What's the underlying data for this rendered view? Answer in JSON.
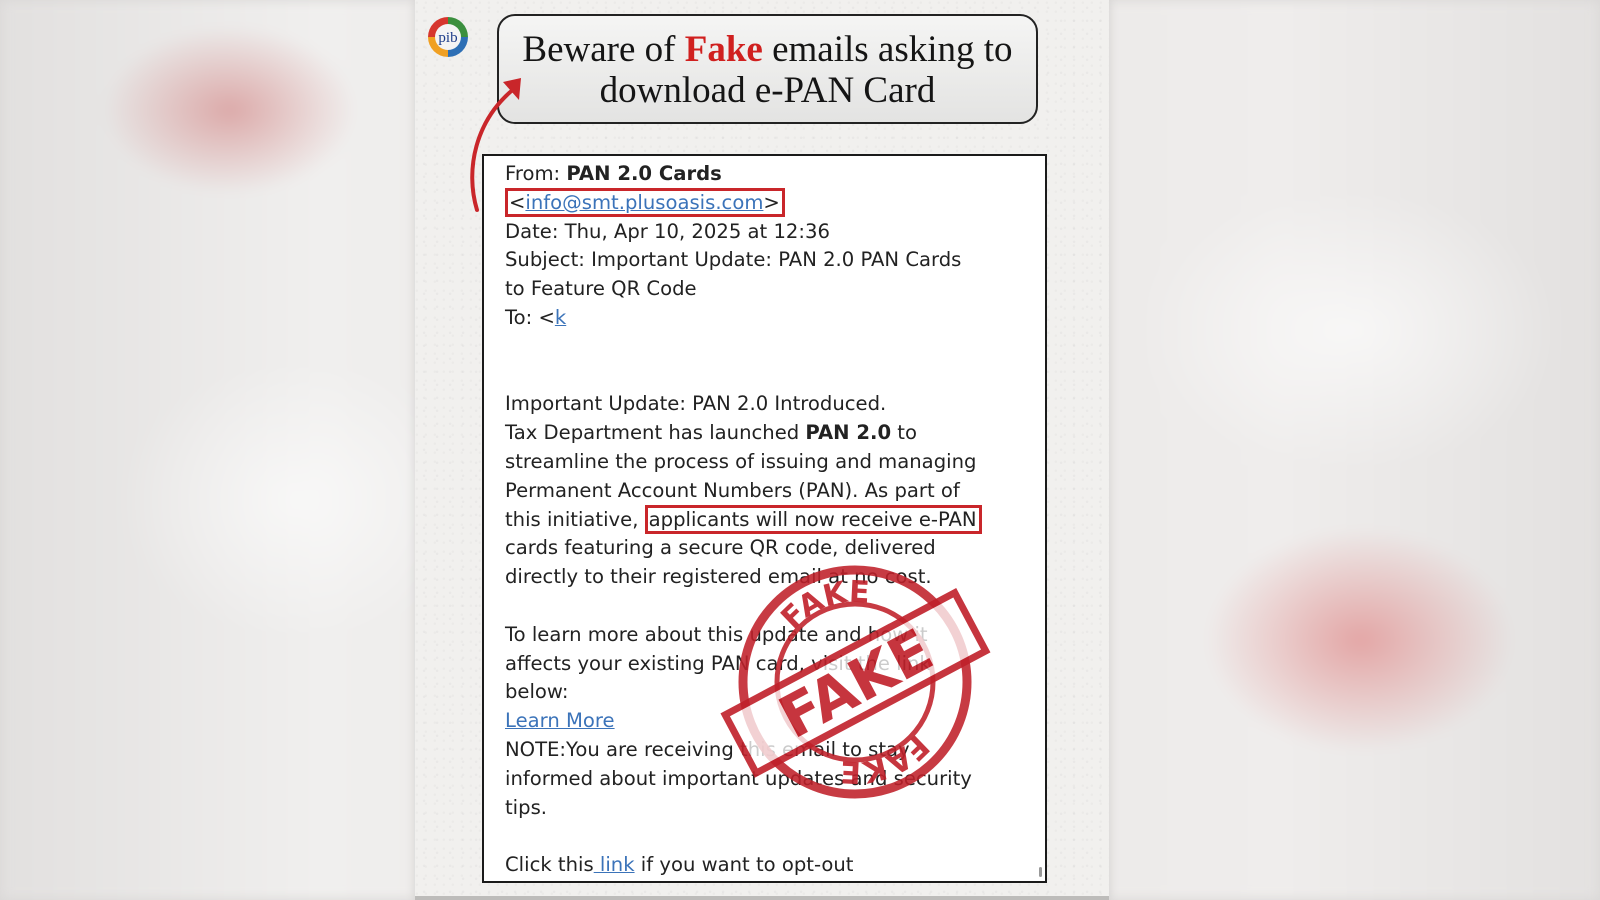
{
  "headline": {
    "part1": "Beware of ",
    "fake_word": "Fake",
    "part2": " emails asking to",
    "line2": "download e-PAN Card"
  },
  "logo": {
    "text": "pib"
  },
  "email": {
    "from_label": "From: ",
    "from_name": "PAN 2.0 Cards",
    "from_address_open": "<",
    "from_address": "info@smt.plusoasis.com",
    "from_address_close": ">",
    "date": "Date: Thu, Apr 10, 2025 at 12:36",
    "subject_line1": "Subject: Important Update: PAN 2.0 PAN Cards",
    "subject_line2": "to Feature QR Code",
    "to_label": "To: <",
    "to_value": "k",
    "body": {
      "l1": "Important Update: PAN 2.0 Introduced.",
      "l2_pre": "Tax Department has launched ",
      "l2_bold": "PAN 2.0",
      "l2_post": " to",
      "l3": "streamline the process of issuing and managing",
      "l4": "Permanent Account Numbers (PAN). As part of",
      "l5_pre": "this initiative, ",
      "l5_highlight": "applicants will now receive e-PAN",
      "l6": "cards featuring a secure QR code, delivered",
      "l7": "directly to their registered email at no cost.",
      "l8": "To learn more about this update and how it",
      "l9": "affects your existing PAN card, visit the link",
      "l10": "below:",
      "learn_more": "Learn More",
      "l11": "NOTE:You are receiving this email to stay",
      "l12": "informed about important updates and security",
      "l13": "tips.",
      "optout_pre": "Click this",
      "optout_link": " link",
      "optout_post": " if you want to opt-out"
    }
  },
  "stamp": {
    "word": "FAKE"
  },
  "colors": {
    "accent_red": "#c9262a",
    "link_blue": "#3b73b9"
  }
}
